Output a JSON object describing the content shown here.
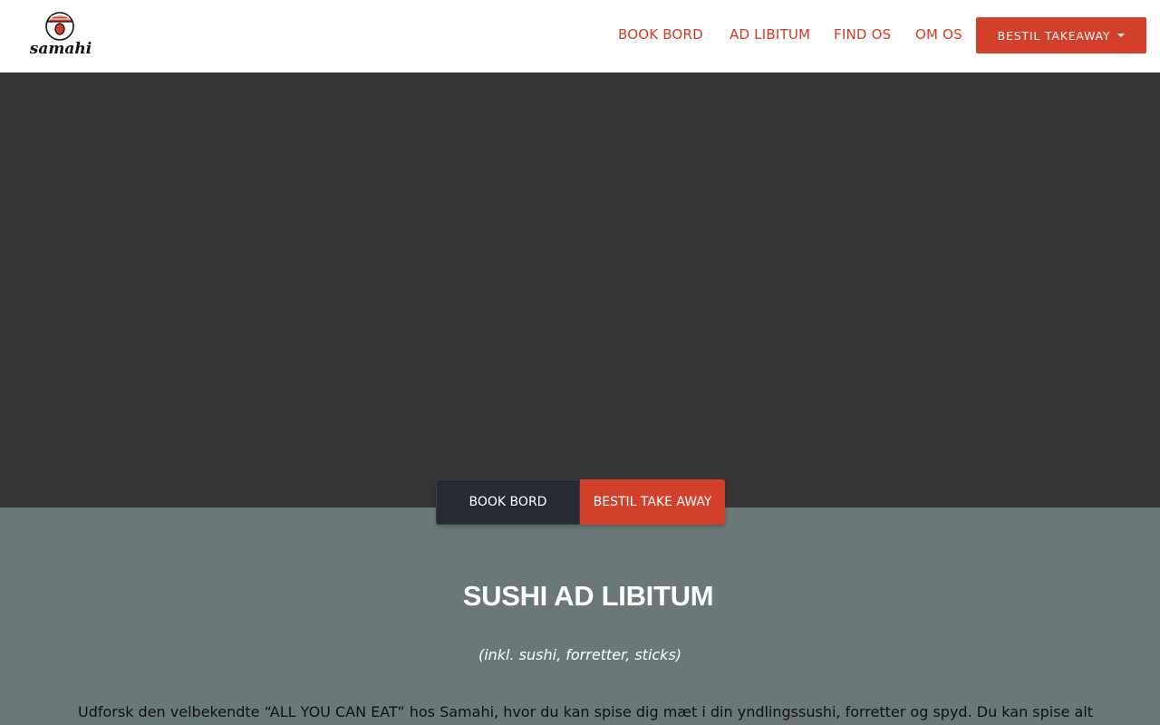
{
  "brand": {
    "logo_text": "samahi",
    "accent_color": "#d0402a",
    "dark_color": "#262b33"
  },
  "nav": {
    "items": [
      {
        "label": "BOOK BORD"
      },
      {
        "label": "AD LIBITUM"
      },
      {
        "label": "FIND OS"
      },
      {
        "label": "OM OS"
      }
    ],
    "dropdown_label": "BESTIL TAKEAWAY",
    "dropdown_icon": "caret-down-icon"
  },
  "hero": {
    "buttons": {
      "book": "BOOK BORD",
      "takeaway": "BESTIL TAKE AWAY"
    }
  },
  "section": {
    "title": "SUSHI AD LIBITUM",
    "subtitle": "(inkl. sushi, forretter, sticks)",
    "body": "Udforsk den velbekendte “ALL YOU CAN EAT” hos Samahi, hvor du kan spise dig mæt i din yndlingssushi, forretter og spyd. Du kan spise alt"
  }
}
